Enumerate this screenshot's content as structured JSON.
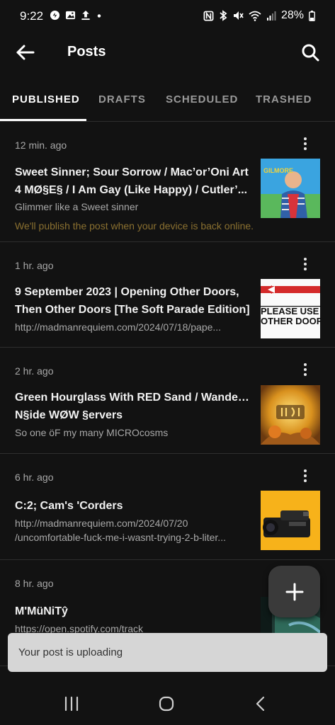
{
  "status_bar": {
    "time": "9:22",
    "battery": "28%",
    "left_icons": [
      "threads-icon",
      "gallery-icon",
      "upload-icon",
      "dot-icon"
    ],
    "right_icons": [
      "nfc-icon",
      "bluetooth-icon",
      "mute-icon",
      "wifi-icon",
      "signal-icon",
      "battery-icon"
    ]
  },
  "app_bar": {
    "title": "Posts",
    "back_icon": "arrow-left-icon",
    "search_icon": "search-icon"
  },
  "tabs": [
    {
      "label": "PUBLISHED",
      "active": true
    },
    {
      "label": "DRAFTS",
      "active": false
    },
    {
      "label": "SCHEDULED",
      "active": false
    },
    {
      "label": "TRASHED",
      "active": false
    }
  ],
  "posts": [
    {
      "time": "12 min. ago",
      "title_lines": [
        "Sweet Sinner; Sour Sorrow / Mac’or’Oni Art",
        "4 MØ§E§ / I Am Gay (Like Happy) / Cutler’..."
      ],
      "subtitle_lines": [
        "Glimmer like a Sweet sinner"
      ],
      "warning": "We'll publish the post when your device is back online.",
      "thumb_text": "GILMORE"
    },
    {
      "time": "1 hr. ago",
      "title_lines": [
        "9 September 2023 | Opening Other Doors,",
        "Then Other Doors [The Soft Parade Edition]"
      ],
      "subtitle_lines": [
        "http://madmanrequiem.com/2024/07/18/pape..."
      ],
      "thumb_text_1": "PLEASE  USE",
      "thumb_text_2": "OTHER DOOR"
    },
    {
      "time": "2 hr. ago",
      "title_lines": [
        "Green Hourglass With RED Sand / Wander'И",
        "N§ide WØW §ervers"
      ],
      "subtitle_lines": [
        "So one öF my many MICROcosms"
      ]
    },
    {
      "time": "6 hr. ago",
      "title_lines": [
        "C:2; Cam's 'Corders"
      ],
      "subtitle_lines": [
        "http://madmanrequiem.com/2024/07/20",
        "/uncomfortable-fuck-me-i-wasnt-trying-2-b-liter..."
      ]
    },
    {
      "time": "8 hr. ago",
      "title_lines": [
        "M'MüNiTŷ"
      ],
      "subtitle_lines": [
        "https://open.spotify.com/track"
      ]
    }
  ],
  "fab": {
    "icon": "plus-icon"
  },
  "snackbar": {
    "text": "Your post is uploading"
  },
  "nav_bar": {
    "icons": [
      "recents-icon",
      "home-icon",
      "back-icon"
    ]
  },
  "colors": {
    "background": "#121212",
    "divider": "#2e2e2e",
    "warning_text": "#8a7030",
    "snackbar_bg": "#d6d6d6",
    "fab_bg": "#3a3a3a"
  }
}
